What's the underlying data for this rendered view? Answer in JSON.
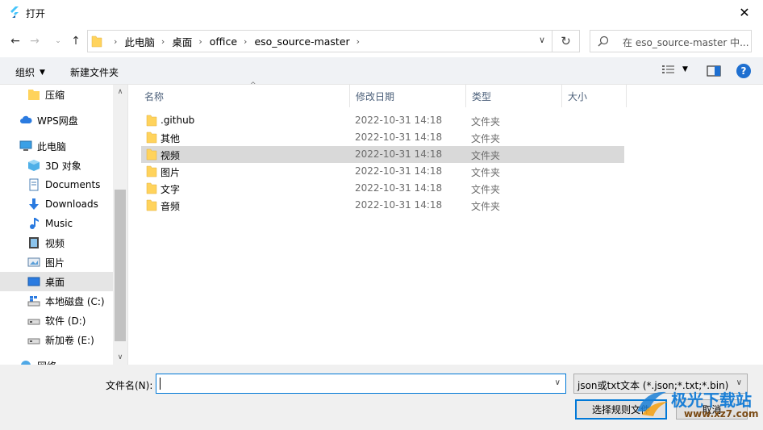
{
  "window": {
    "title": "打开"
  },
  "address": {
    "crumbs": [
      "此电脑",
      "桌面",
      "office",
      "eso_source-master"
    ]
  },
  "search": {
    "placeholder": "在 eso_source-master 中..."
  },
  "toolbar": {
    "organize": "组织",
    "new_folder": "新建文件夹"
  },
  "nav": {
    "items": [
      {
        "label": "压缩",
        "icon": "folder-icon"
      },
      {
        "label": "WPS网盘",
        "icon": "cloud-icon"
      },
      {
        "label": "此电脑",
        "icon": "computer-icon"
      },
      {
        "label": "3D 对象",
        "icon": "cube-icon"
      },
      {
        "label": "Documents",
        "icon": "document-icon"
      },
      {
        "label": "Downloads",
        "icon": "download-icon"
      },
      {
        "label": "Music",
        "icon": "music-icon"
      },
      {
        "label": "视频",
        "icon": "video-icon"
      },
      {
        "label": "图片",
        "icon": "picture-icon"
      },
      {
        "label": "桌面",
        "icon": "desktop-icon"
      },
      {
        "label": "本地磁盘 (C:)",
        "icon": "drive-icon"
      },
      {
        "label": "软件 (D:)",
        "icon": "drive-icon"
      },
      {
        "label": "新加卷 (E:)",
        "icon": "drive-icon"
      },
      {
        "label": "网络",
        "icon": "network-icon"
      }
    ],
    "selected": "桌面"
  },
  "columns": {
    "name": "名称",
    "date": "修改日期",
    "type": "类型",
    "size": "大小"
  },
  "files": [
    {
      "name": ".github",
      "date": "2022-10-31 14:18",
      "type": "文件夹"
    },
    {
      "name": "其他",
      "date": "2022-10-31 14:18",
      "type": "文件夹"
    },
    {
      "name": "视频",
      "date": "2022-10-31 14:18",
      "type": "文件夹"
    },
    {
      "name": "图片",
      "date": "2022-10-31 14:18",
      "type": "文件夹"
    },
    {
      "name": "文字",
      "date": "2022-10-31 14:18",
      "type": "文件夹"
    },
    {
      "name": "音频",
      "date": "2022-10-31 14:18",
      "type": "文件夹"
    }
  ],
  "selected_file": "视频",
  "bottom": {
    "filename_label": "文件名(N):",
    "filename_value": "",
    "filter": "json或txt文本 (*.json;*.txt;*.bin)",
    "open_label": "选择规则文件",
    "cancel_label": "取消"
  },
  "watermark": {
    "text": "极光下载站",
    "url": "www.xz7.com"
  },
  "colors": {
    "accent": "#0078d7",
    "folder": "#ffd35c",
    "selection": "#d9d9d9"
  }
}
